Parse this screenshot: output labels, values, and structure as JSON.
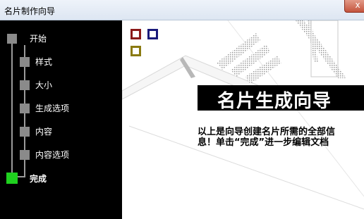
{
  "window": {
    "title": "名片制作向导",
    "close_glyph": "x"
  },
  "steps": [
    {
      "label": "开始",
      "state": "pending"
    },
    {
      "label": "样式",
      "state": "pending"
    },
    {
      "label": "大小",
      "state": "pending"
    },
    {
      "label": "生成选项",
      "state": "pending"
    },
    {
      "label": "内容",
      "state": "pending"
    },
    {
      "label": "内容选项",
      "state": "pending"
    },
    {
      "label": "完成",
      "state": "current"
    }
  ],
  "main": {
    "heading": "名片生成向导",
    "description_line1": "以上是向导创建名片所需的全部信",
    "description_line2": "息！单击“完成”进一步编辑文档"
  },
  "colors": {
    "sidebar_bg": "#000000",
    "step_pending": "#8a8a8a",
    "step_current": "#1fd11f",
    "logo_red": "#8b1a1a",
    "logo_navy": "#1a1a7a",
    "logo_olive": "#8a7a10"
  }
}
